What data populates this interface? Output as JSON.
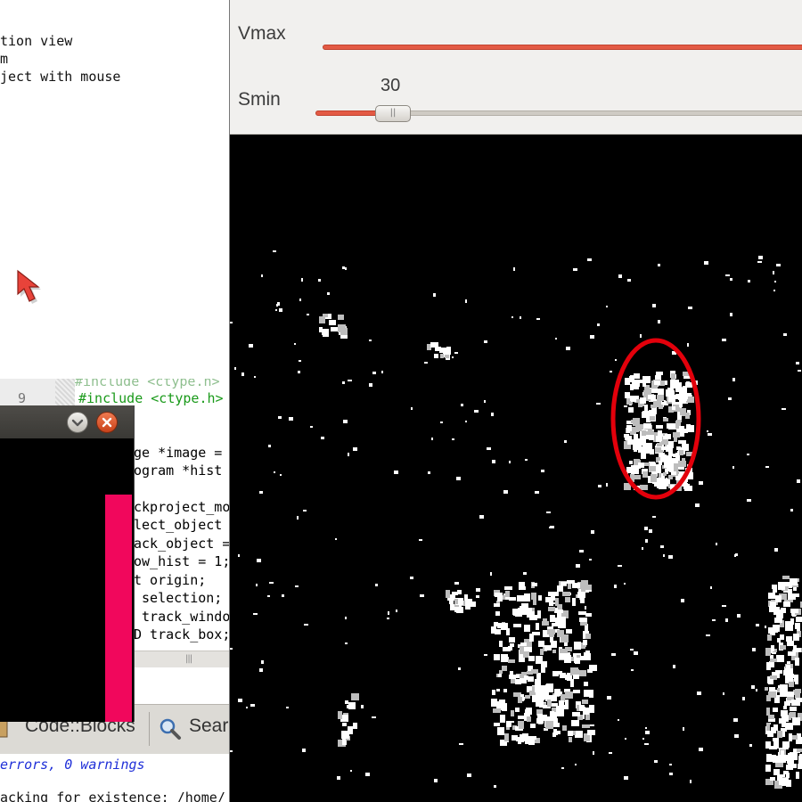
{
  "console": {
    "lines": [
      "tion view",
      "m",
      "ject with mouse"
    ]
  },
  "editor": {
    "cut_line": "#include <ctype.h>",
    "line_number": "9",
    "include": "#include <ctype.h>",
    "code_lines": [
      "ge *image = ",
      "ogram *hist ",
      "",
      "ckproject_mo",
      "lect_object ",
      "ack_object =",
      "ow_hist = 1;",
      "t origin;",
      " selection;",
      " track_windo",
      "D track_box;"
    ]
  },
  "tabs": {
    "codeblocks": "Code::Blocks",
    "search": "Sear"
  },
  "log": {
    "line1": "errors, 0 warnings",
    "line2": "acking for existence: /home/"
  },
  "controls": {
    "vmax_label": "Vmax",
    "smin_label": "Smin",
    "smin_value": "30",
    "vmax_level": 1.0,
    "smin_level": 0.12
  },
  "colors": {
    "accent_fill": "#e35a44",
    "tracking_ellipse": "#e3000b",
    "histogram_bar": "#f1075c",
    "close_button": "#d8502a"
  }
}
